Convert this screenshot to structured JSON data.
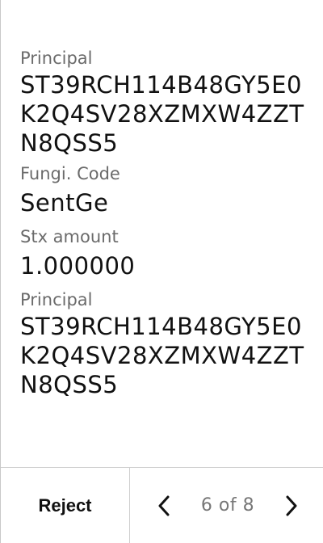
{
  "fields": [
    {
      "label": "Principal",
      "value": "ST39RCH114B48GY5E0K2Q4SV28XZMXW4ZZTN8QSS5"
    },
    {
      "label": "Fungi. Code",
      "value": "SentGe"
    },
    {
      "label": "Stx amount",
      "value": "1.000000"
    },
    {
      "label": "Principal",
      "value": "ST39RCH114B48GY5E0K2Q4SV28XZMXW4ZZTN8QSS5"
    }
  ],
  "footer": {
    "reject_label": "Reject",
    "prev_icon": "chevron-left-icon",
    "next_icon": "chevron-right-icon",
    "page_indicator": "6 of 8"
  },
  "colors": {
    "label": "#6b6b6b",
    "value": "#111111",
    "divider": "#cfcfcf"
  }
}
